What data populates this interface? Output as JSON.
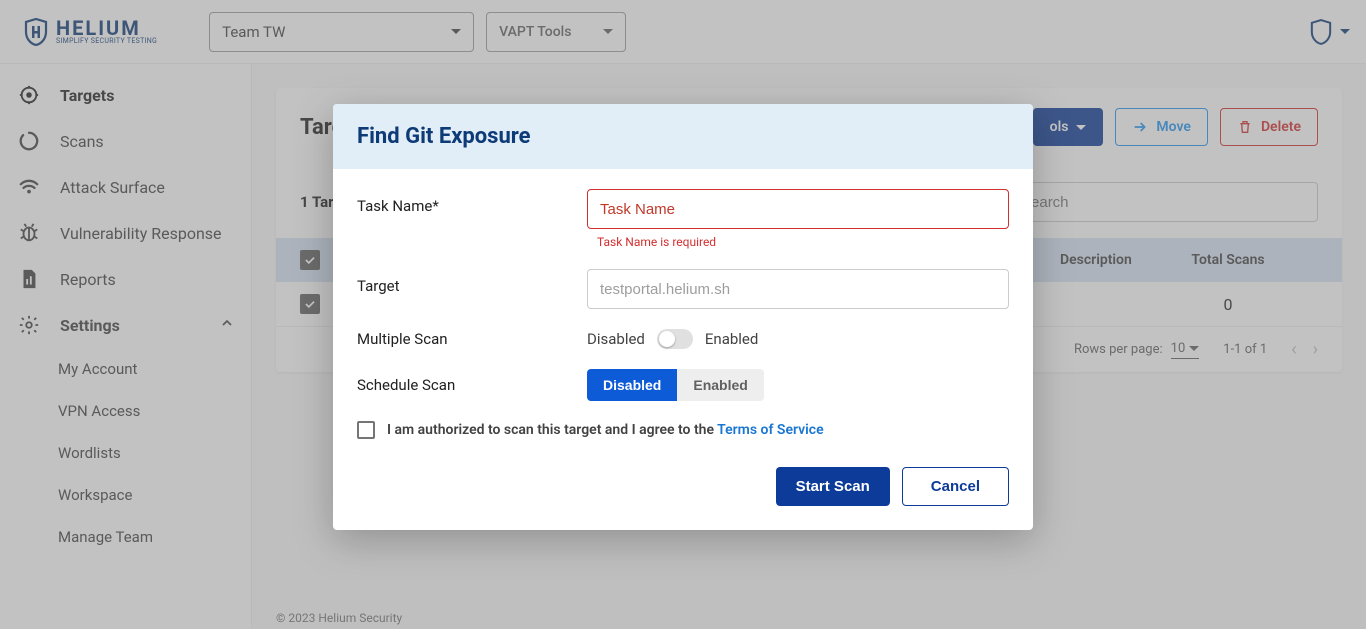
{
  "header": {
    "brand": "HELIUM",
    "tagline": "SIMPLIFY SECURITY TESTING",
    "team_select": "Team TW",
    "tools_select": "VAPT Tools"
  },
  "sidebar": {
    "items": [
      {
        "label": "Targets",
        "active": true
      },
      {
        "label": "Scans"
      },
      {
        "label": "Attack Surface"
      },
      {
        "label": "Vulnerability Response"
      },
      {
        "label": "Reports"
      },
      {
        "label": "Settings",
        "expanded": true
      }
    ],
    "settings_children": [
      {
        "label": "My Account"
      },
      {
        "label": "VPN Access"
      },
      {
        "label": "Wordlists"
      },
      {
        "label": "Workspace"
      },
      {
        "label": "Manage Team"
      }
    ]
  },
  "page": {
    "title": "Targets",
    "tools_btn": "ols",
    "move_btn": "Move",
    "delete_btn": "Delete",
    "count_prefix": "1 ",
    "count_label": "Targets",
    "search_placeholder": "Search",
    "columns": {
      "description": "Description",
      "total_scans": "Total Scans"
    },
    "rows": [
      {
        "scans": "0"
      }
    ],
    "pagination": {
      "rows_label": "Rows per page:",
      "rows_value": "10",
      "range": "1-1 of 1"
    }
  },
  "modal": {
    "title": "Find Git Exposure",
    "task_name_label": "Task Name*",
    "task_name_placeholder": "Task Name",
    "task_name_error": "Task Name is required",
    "target_label": "Target",
    "target_placeholder": "testportal.helium.sh",
    "multiple_scan_label": "Multiple Scan",
    "disabled_text": "Disabled",
    "enabled_text": "Enabled",
    "schedule_scan_label": "Schedule Scan",
    "schedule_disabled": "Disabled",
    "schedule_enabled": "Enabled",
    "consent_text_1": "I am authorized to scan this target and I agree to the ",
    "consent_link": "Terms of Service",
    "start_btn": "Start Scan",
    "cancel_btn": "Cancel"
  },
  "footer": "© 2023 Helium Security"
}
